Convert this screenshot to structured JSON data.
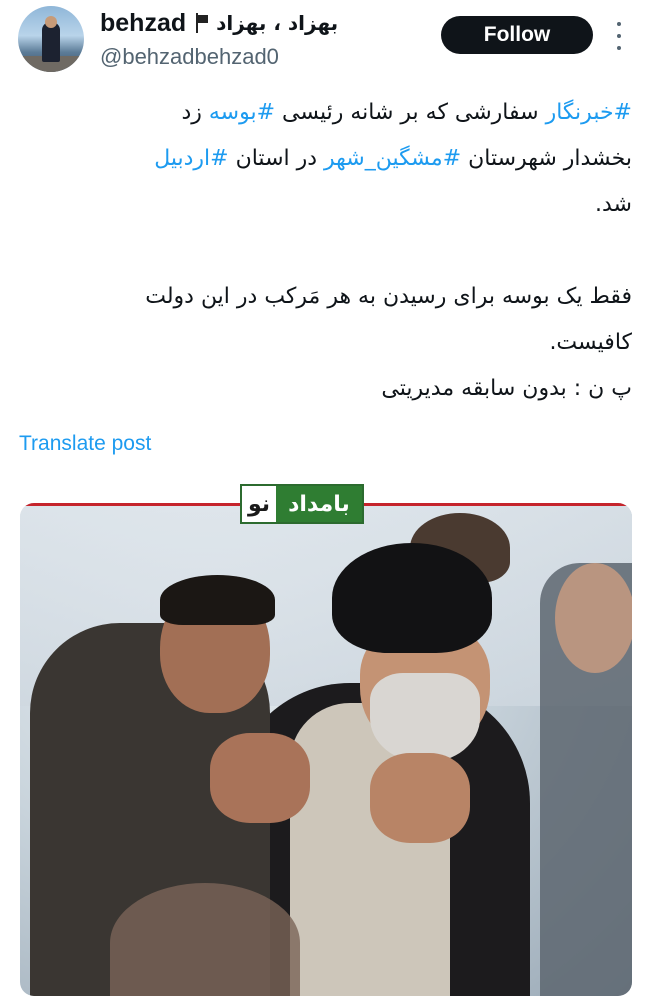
{
  "user": {
    "avatar_icon": "user-avatar",
    "display_name_en": "behzad",
    "flag_icon": "flag-icon",
    "display_name_fa": "بهزاد ، بهزاد",
    "handle": "@behzadbehzad0"
  },
  "actions": {
    "follow_label": "Follow",
    "more_icon": "more-options-icon"
  },
  "post": {
    "line1": {
      "tag1": "#خبرنگار",
      "text1": " سفارشی که بر شانه رئیسی ",
      "tag2": "#بوسه",
      "text2": " زد"
    },
    "line2": {
      "text1": "بخشدار شهرستان ",
      "tag1": "#مشگین_شهر",
      "text2": " در استان ",
      "tag2": "#اردبیل"
    },
    "line3": "شد.",
    "line4": "فقط یک بوسه برای رسیدن به هر مَرکب در این دولت",
    "line5": "کافیست.",
    "line6": "پ ن : بدون سابقه مدیریتی"
  },
  "translate_label": "Translate post",
  "media": {
    "logo_left": "نو",
    "logo_right": "بامداد"
  },
  "colors": {
    "link": "#1d9bf0",
    "text": "#0f1419",
    "muted": "#536471",
    "follow_bg": "#0f1419",
    "logo_green": "#2f7d32",
    "logo_red_line": "#c5242c"
  }
}
